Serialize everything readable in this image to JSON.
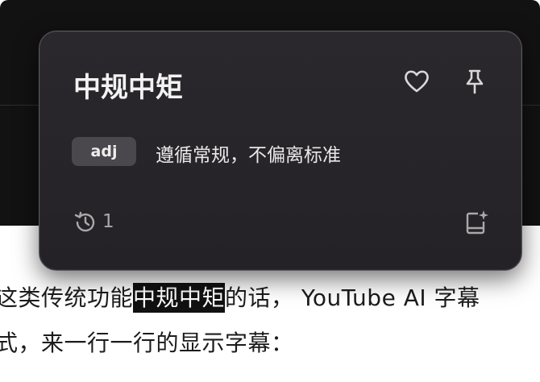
{
  "background": {
    "article_line1_before": "这类传统功能",
    "article_line1_highlight": "中规中矩",
    "article_line1_after": "的话，  YouTube AI 字幕",
    "article_line2": "式，来一行一行的显示字幕："
  },
  "popup": {
    "word": "中规中矩",
    "part_of_speech": "adj",
    "definition": "遵循常规，不偏离标准",
    "history_count": "1",
    "icons": {
      "favorite": "heart-icon",
      "pin": "pin-icon",
      "history": "history-icon",
      "notebook": "notebook-sparkle-icon"
    }
  },
  "colors": {
    "popup_bg": "#27252a",
    "badge_bg": "#4a484c",
    "highlight_bg": "#111111"
  }
}
